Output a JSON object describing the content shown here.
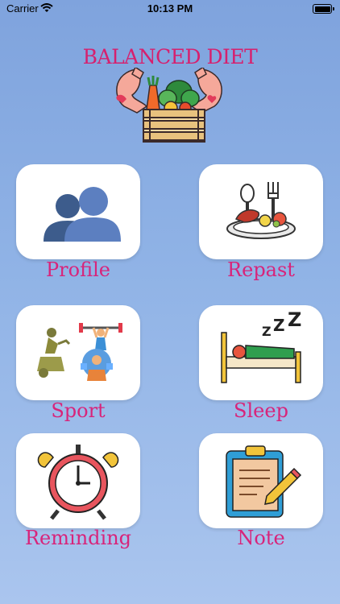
{
  "status_bar": {
    "carrier": "Carrier",
    "time": "10:13 PM"
  },
  "header": {
    "title": "BALANCED DIET"
  },
  "tiles": [
    {
      "label": "Profile",
      "icon": "profile-icon"
    },
    {
      "label": "Repast",
      "icon": "meal-icon"
    },
    {
      "label": "Sport",
      "icon": "sport-icon"
    },
    {
      "label": "Sleep",
      "icon": "sleep-icon"
    },
    {
      "label": "Reminding",
      "icon": "alarm-clock-icon"
    },
    {
      "label": "Note",
      "icon": "clipboard-icon"
    }
  ],
  "colors": {
    "title": "#d6206e",
    "label": "#d8247a",
    "background": "#8aaee3",
    "card": "#ffffff"
  }
}
